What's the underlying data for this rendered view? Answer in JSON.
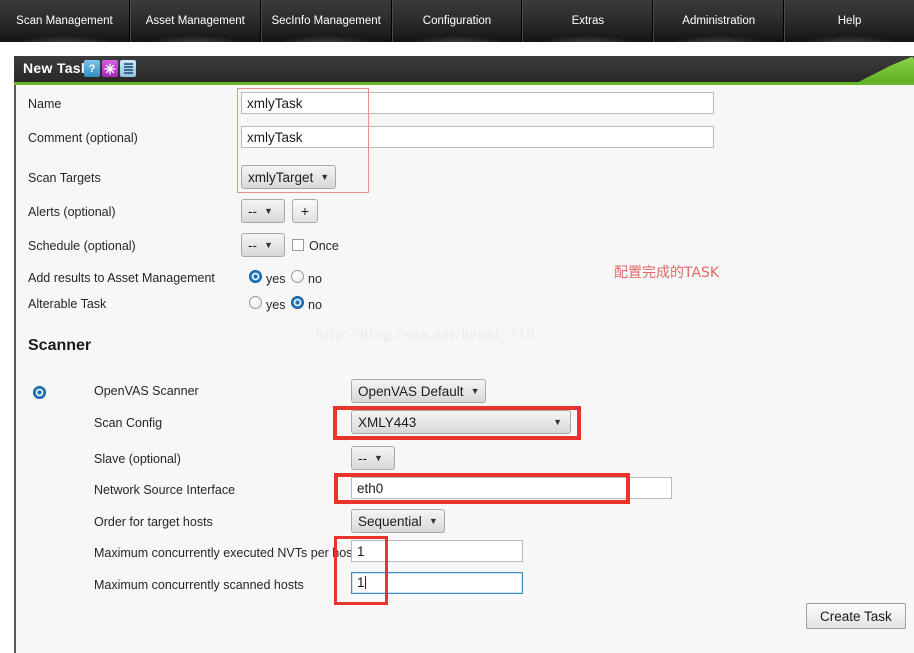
{
  "nav": {
    "tabs": [
      {
        "label": "Scan Management"
      },
      {
        "label": "Asset Management"
      },
      {
        "label": "SecInfo Management"
      },
      {
        "label": "Configuration"
      },
      {
        "label": "Extras"
      },
      {
        "label": "Administration"
      },
      {
        "label": "Help"
      }
    ]
  },
  "panel": {
    "title": "New Task",
    "icons": [
      {
        "name": "help-icon",
        "glyph": "?"
      },
      {
        "name": "new-task-icon",
        "glyph": ""
      },
      {
        "name": "task-list-icon",
        "glyph": ""
      }
    ]
  },
  "form": {
    "name": {
      "label": "Name",
      "value": "xmlyTask"
    },
    "comment": {
      "label": "Comment (optional)",
      "value": "xmlyTask"
    },
    "scan_targets": {
      "label": "Scan Targets",
      "value": "xmlyTarget"
    },
    "alerts": {
      "label": "Alerts (optional)",
      "value": "--",
      "add_label": "+"
    },
    "schedule": {
      "label": "Schedule (optional)",
      "value": "--",
      "once_label": "Once"
    },
    "add_results": {
      "label": "Add results to Asset Management",
      "yes_label": "yes",
      "no_label": "no",
      "selected": "yes"
    },
    "alterable": {
      "label": "Alterable Task",
      "yes_label": "yes",
      "no_label": "no",
      "selected": "no"
    }
  },
  "scanner": {
    "section_title": "Scanner",
    "openvas_scanner": {
      "label": "OpenVAS Scanner",
      "value": "OpenVAS Default"
    },
    "scan_config": {
      "label": "Scan Config",
      "value": "XMLY443"
    },
    "slave": {
      "label": "Slave (optional)",
      "value": "--"
    },
    "network_source_interface": {
      "label": "Network Source Interface",
      "value": "eth0"
    },
    "order_for_target_hosts": {
      "label": "Order for target hosts",
      "value": "Sequential"
    },
    "max_nvts": {
      "label": "Maximum concurrently executed NVTs per host",
      "value": "1"
    },
    "max_hosts": {
      "label": "Maximum concurrently scanned hosts",
      "value": "1"
    }
  },
  "actions": {
    "create_task": "Create Task"
  },
  "annotations": {
    "chinese_note": "配置完成的TASK",
    "watermark": "http://blog.csdn.net/henni_719",
    "highlight_color": "#e8342c",
    "soft_highlight_color": "#e8908f"
  }
}
